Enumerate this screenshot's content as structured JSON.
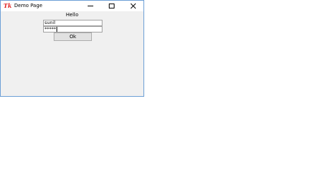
{
  "window": {
    "title": "Demo Page",
    "app_icon_text": "Tk",
    "controls": {
      "minimize": "minimize-icon",
      "maximize": "maximize-icon",
      "close": "close-icon"
    }
  },
  "form": {
    "heading": "Hello",
    "username_value": "sunil",
    "password_value": "*****",
    "ok_label": "Ok"
  },
  "colors": {
    "window_border": "#6b9ed6",
    "client_background": "#f0f0f0",
    "icon_red": "#e02020"
  }
}
